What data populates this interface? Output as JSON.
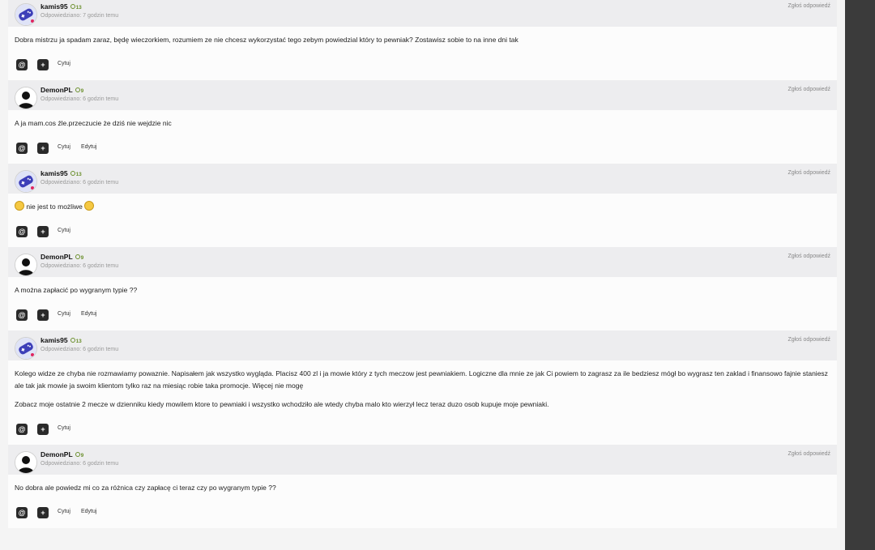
{
  "posts": [
    {
      "author": "kamis95",
      "avatar": "gamepad-avatar",
      "reputation": "13",
      "time": "Odpowiedziano: 7 godzin temu",
      "report": "Zgłoś odpowiedź",
      "paragraphs": [
        "Dobra mistrzu ja spadam zaraz, będę wieczorkiem, rozumiem ze nie chcesz wykorzystać tego zebym powiedzial który to pewniak? Zostawisz sobie to na inne dni tak"
      ],
      "actions": [
        "Cytuj"
      ]
    },
    {
      "author": "DemonPL",
      "avatar": "default-user-avatar",
      "reputation": "9",
      "time": "Odpowiedziano: 6 godzin temu",
      "report": "Zgłoś odpowiedź",
      "paragraphs": [
        "A ja mam.cos źle.przeczucie że dziś nie wejdzie nic"
      ],
      "actions": [
        "Cytuj",
        "Edytuj"
      ]
    },
    {
      "author": "kamis95",
      "avatar": "gamepad-avatar",
      "reputation": "13",
      "time": "Odpowiedziano: 6 godzin temu",
      "report": "Zgłoś odpowiedź",
      "paragraphs": [
        "nie jest to możliwe"
      ],
      "smileys": true,
      "actions": [
        "Cytuj"
      ]
    },
    {
      "author": "DemonPL",
      "avatar": "default-user-avatar",
      "reputation": "9",
      "time": "Odpowiedziano: 6 godzin temu",
      "report": "Zgłoś odpowiedź",
      "paragraphs": [
        "A można zapłacić po wygranym typie ??"
      ],
      "actions": [
        "Cytuj",
        "Edytuj"
      ]
    },
    {
      "author": "kamis95",
      "avatar": "gamepad-avatar",
      "reputation": "13",
      "time": "Odpowiedziano: 6 godzin temu",
      "report": "Zgłoś odpowiedź",
      "paragraphs": [
        "Kolego widze ze chyba nie rozmawiamy powaznie. Napisałem jak wszystko wygląda. Placisz 400 zl i ja mowie który z tych meczow jest pewniakiem. Logiczne dla mnie ze jak Ci powiem to zagrasz za ile bedziesz mógł bo wygrasz ten zaklad i finansowo fajnie staniesz ale tak jak mowie ja swoim klientom tylko raz na miesiąc robie taka promocje. Więcej nie mogę",
        "Zobacz moje ostatnie 2 mecze w dzienniku kiedy mowilem ktore to pewniaki i wszystko wchodziło ale wtedy chyba malo kto wierzył lecz teraz duzo osob kupuje moje pewniaki."
      ],
      "actions": [
        "Cytuj"
      ]
    },
    {
      "author": "DemonPL",
      "avatar": "default-user-avatar",
      "reputation": "9",
      "time": "Odpowiedziano: 6 godzin temu",
      "report": "Zgłoś odpowiedź",
      "paragraphs": [
        "No dobra ale powiedz mi co za różnica czy zapłacę ci teraz czy po wygranym typie ??"
      ],
      "actions": [
        "Cytuj",
        "Edytuj"
      ]
    }
  ],
  "colors": {
    "accent_dark": "#2a2a2a",
    "header_bg": "#ededef",
    "rep_green": "#6a8f2c",
    "scroll_rail": "#3b3b3b"
  }
}
